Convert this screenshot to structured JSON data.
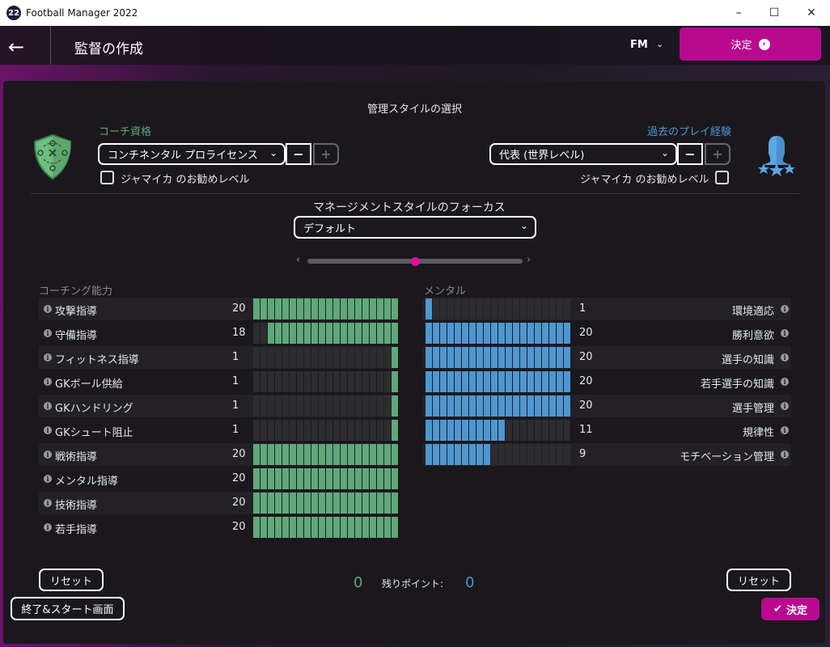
{
  "window": {
    "title": "Football Manager 2022",
    "logo": "22",
    "min": "–",
    "max": "☐",
    "close": "✕"
  },
  "header": {
    "title": "監督の作成",
    "brand": "FM",
    "confirm": "決定"
  },
  "main": {
    "section_title": "管理スタイルの選択",
    "coach": {
      "label": "コーチ資格",
      "value": "コンチネンタル プロライセンス",
      "minus": "−",
      "plus": "+",
      "recommend": "ジャマイカ のお勧めレベル",
      "recommend_checked": false
    },
    "playing": {
      "label": "過去のプレイ経験",
      "value": "代表 (世界レベル)",
      "minus": "−",
      "plus": "+",
      "recommend": "ジャマイカ のお勧めレベル",
      "recommend_checked": false
    },
    "focus": {
      "label": "マネージメントスタイルのフォーカス",
      "value": "デフォルト",
      "slider_value": 0.5
    }
  },
  "coaching": {
    "title": "コーチング能力",
    "color": "#5fa87a",
    "items": [
      {
        "label": "攻撃指導",
        "value": 20
      },
      {
        "label": "守備指導",
        "value": 18
      },
      {
        "label": "フィットネス指導",
        "value": 1
      },
      {
        "label": "GKボール供給",
        "value": 1
      },
      {
        "label": "GKハンドリング",
        "value": 1
      },
      {
        "label": "GKシュート阻止",
        "value": 1
      },
      {
        "label": "戦術指導",
        "value": 20
      },
      {
        "label": "メンタル指導",
        "value": 20
      },
      {
        "label": "技術指導",
        "value": 20
      },
      {
        "label": "若手指導",
        "value": 20
      }
    ]
  },
  "mental": {
    "title": "メンタル",
    "color": "#4f97d1",
    "items": [
      {
        "label": "環境適応",
        "value": 1
      },
      {
        "label": "勝利意欲",
        "value": 20
      },
      {
        "label": "選手の知識",
        "value": 20
      },
      {
        "label": "若手選手の知識",
        "value": 20
      },
      {
        "label": "選手管理",
        "value": 20
      },
      {
        "label": "規律性",
        "value": 11
      },
      {
        "label": "モチベーション管理",
        "value": 9
      }
    ]
  },
  "footer": {
    "reset_left": "リセット",
    "reset_right": "リセット",
    "points_left": "0",
    "points_label": "残りポイント:",
    "points_right": "0",
    "exit": "終了&スタート画面",
    "confirm": "決定"
  }
}
